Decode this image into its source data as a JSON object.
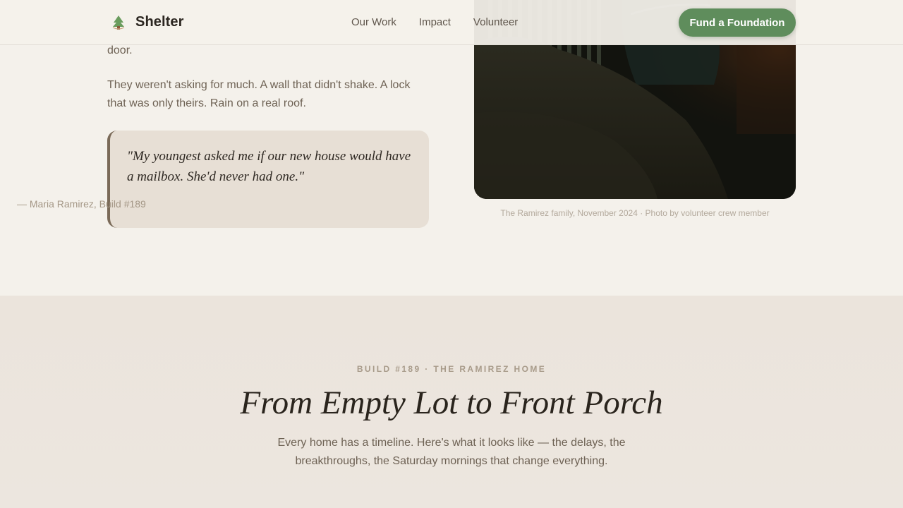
{
  "header": {
    "brand": "Shelter",
    "logo_icon": "house-tree-icon",
    "nav": [
      "Our Work",
      "Impact",
      "Volunteer"
    ],
    "cta_label": "Fund a Foundation",
    "colors": {
      "accent": "#5f8d5c",
      "background": "#f4f1eb"
    }
  },
  "story": {
    "paragraph_tail": "door.",
    "paragraph_2": "They weren't asking for much. A wall that didn't shake. A lock that was only theirs. Rain on a real roof.",
    "quote": {
      "text": "\"My youngest asked me if our new house would have a mailbox. She'd never had one.\"",
      "citation": "— Maria Ramirez, Build #189"
    },
    "photo": {
      "caption": "The Ramirez family, November 2024 · Photo by volunteer crew member"
    }
  },
  "timeline_intro": {
    "eyebrow": "BUILD #189 · THE RAMIREZ HOME",
    "title": "From Empty Lot to Front Porch",
    "lede": "Every home has a timeline. Here's what it looks like — the delays, the breakthroughs, the Saturday mornings that change everything."
  }
}
